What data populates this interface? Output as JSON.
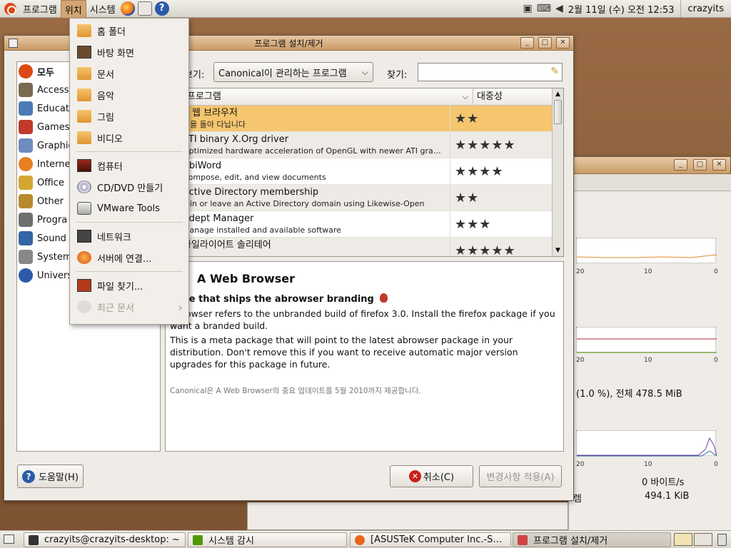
{
  "top_panel": {
    "menus": [
      "프로그램",
      "위치",
      "시스템"
    ],
    "clock": "2월 11일 (수) 오전 12:53",
    "user": "crazyits"
  },
  "places_menu": {
    "items": [
      {
        "label": "홈 폴더",
        "icon": "home-folder-icon"
      },
      {
        "label": "바탕 화면",
        "icon": "desktop-icon"
      },
      {
        "label": "문서",
        "icon": "folder-icon"
      },
      {
        "label": "음악",
        "icon": "folder-icon"
      },
      {
        "label": "그림",
        "icon": "folder-icon"
      },
      {
        "label": "비디오",
        "icon": "folder-icon"
      },
      {
        "label": "컴퓨터",
        "icon": "computer-icon"
      },
      {
        "label": "CD/DVD 만들기",
        "icon": "cd-icon"
      },
      {
        "label": "VMware Tools",
        "icon": "drive-icon"
      },
      {
        "label": "네트워크",
        "icon": "network-icon"
      },
      {
        "label": "서버에 연결...",
        "icon": "server-icon"
      },
      {
        "label": "파일 찾기...",
        "icon": "search-icon"
      },
      {
        "label": "최근 문서",
        "icon": "recent-icon",
        "disabled": true
      }
    ]
  },
  "main_window": {
    "title": "프로그램 설치/제거",
    "filter_label": "보기:",
    "filter_value": "Canonical이 관리하는 프로그램",
    "search_label": "찾기:",
    "search_value": "",
    "categories": [
      "모두",
      "Access",
      "Educat",
      "Games",
      "Graphic",
      "Interne",
      "Office",
      "Other",
      "Progra",
      "Sound",
      "System",
      "Univers"
    ],
    "columns": {
      "program": "프로그램",
      "popularity": "대중성"
    },
    "apps": [
      {
        "name": "A 웹 브라우저",
        "desc": "웹을 돌아 다닙니다",
        "stars": "★★",
        "selected": true
      },
      {
        "name": "ATI binary X.Org driver",
        "desc": "Optimized hardware acceleration of OpenGL with newer ATI gra…",
        "stars": "★★★★★"
      },
      {
        "name": "AbiWord",
        "desc": "Compose, edit, and view documents",
        "stars": "★★★★"
      },
      {
        "name": "Active Directory membership",
        "desc": "Join or leave an Active Directory domain using Likewise-Open",
        "stars": "★★"
      },
      {
        "name": "Adept Manager",
        "desc": "Manage installed and available software",
        "stars": "★★★"
      },
      {
        "name": "아일라이어트 솔리테어",
        "desc": "",
        "stars": "★★★★★"
      }
    ],
    "detail": {
      "title": "A Web Browser",
      "subtitle": "kage that ships the abrowser branding",
      "para1": "ABrowser refers to the unbranded build of firefox 3.0. Install the firefox package if you want a branded build.",
      "para2": "This is a meta package that will point to the latest abrowser package in your distribution. Don't remove this if you want to receive automatic major version upgrades for this package in future.",
      "note": "Canonical은 A Web Browser의 중요 업데이트를 5월 2010까지 제공합니다."
    },
    "help_button": "도움말(H)",
    "cancel_button": "취소(C)",
    "apply_button": "변경사항 적용(A)"
  },
  "monitor_window": {
    "ticks": [
      "20",
      "10",
      "0"
    ],
    "memory_text": "(1.0 %), 전체 478.5 MiB",
    "net_rate": "0 바이트/s",
    "net_partial_label": "렘",
    "net_total": "494.1 KiB"
  },
  "taskbar": {
    "tasks": [
      {
        "label": "crazyits@crazyits-desktop: ~"
      },
      {
        "label": "시스템 감시"
      },
      {
        "label": "[ASUSTeK Computer Inc.-S…"
      },
      {
        "label": "프로그램 설치/제거",
        "active": true
      }
    ]
  },
  "colors": {
    "accent": "#d2a574",
    "selected_row": "#f5c66f",
    "ubuntu_orange": "#dd4814"
  }
}
